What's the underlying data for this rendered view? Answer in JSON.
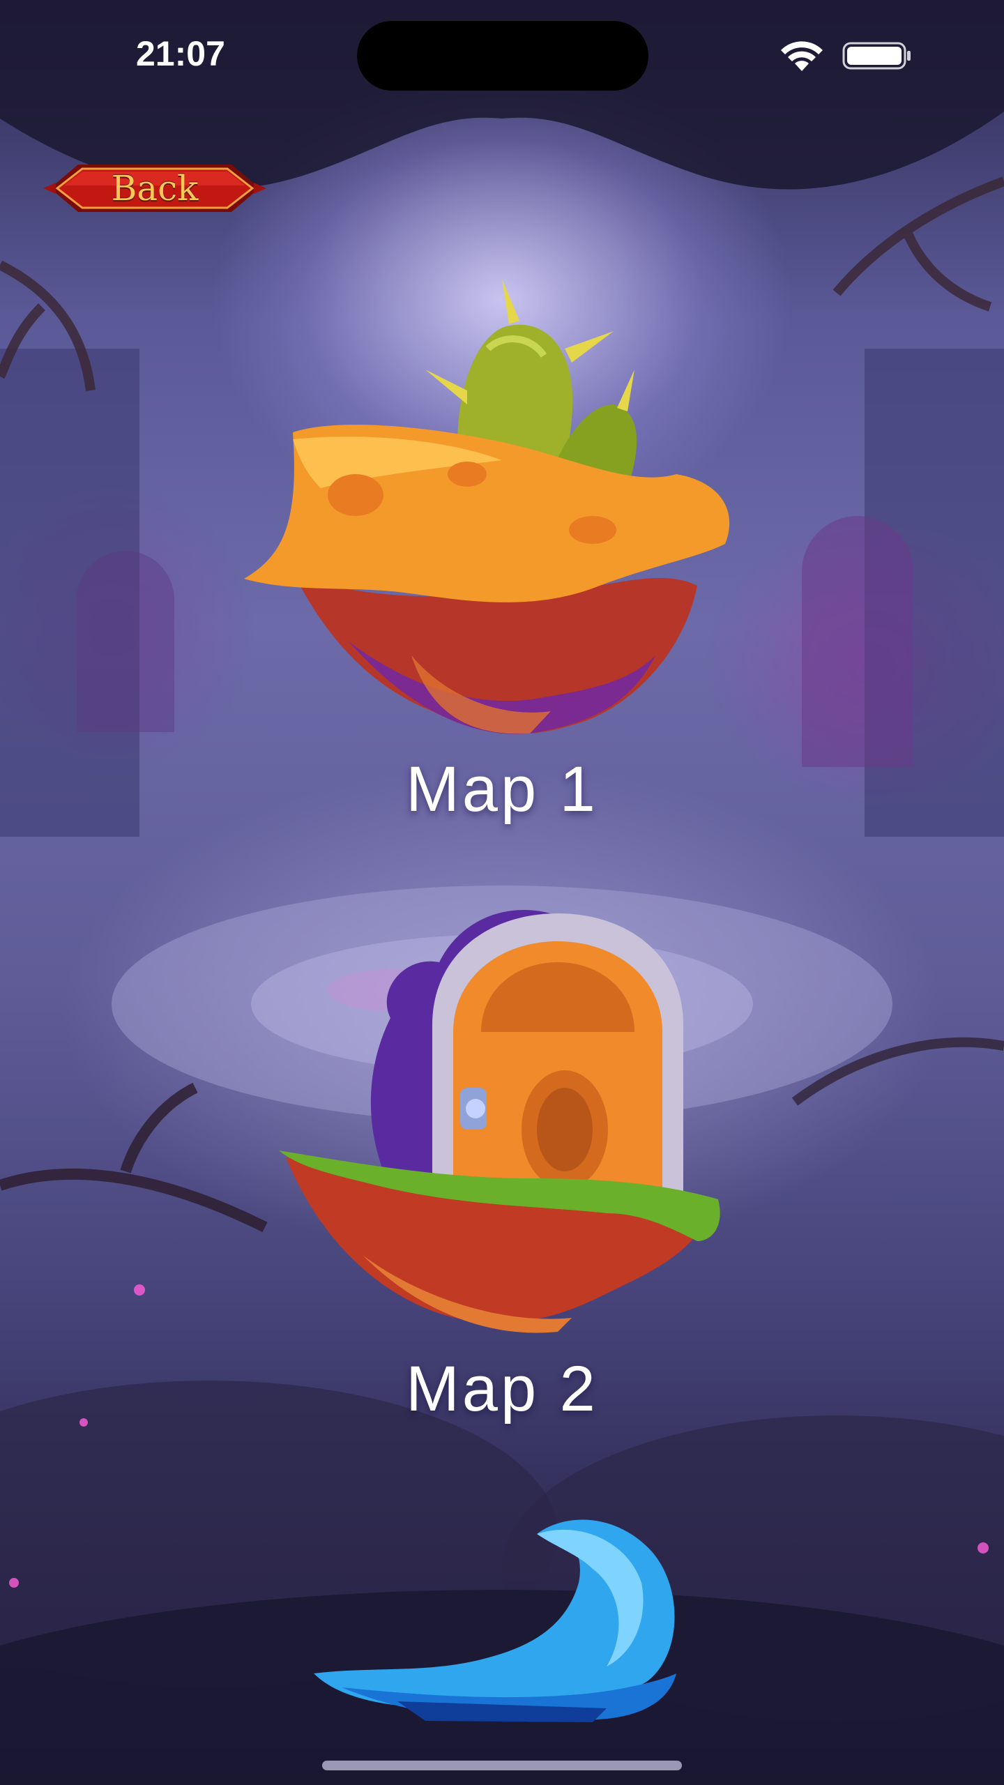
{
  "status_bar": {
    "time": "21:07",
    "wifi_icon": "wifi-icon",
    "battery_icon": "battery-icon"
  },
  "header": {
    "back_label": "Back"
  },
  "maps": [
    {
      "label": "Map 1",
      "icon": "cactus-island-icon"
    },
    {
      "label": "Map 2",
      "icon": "door-island-icon"
    },
    {
      "icon": "water-wave-island-icon"
    }
  ],
  "colors": {
    "back_button_red": "#c21812",
    "back_label_gold": "#f7c75a",
    "label_white": "#ffffff",
    "background_violet": "#5b5a98"
  }
}
